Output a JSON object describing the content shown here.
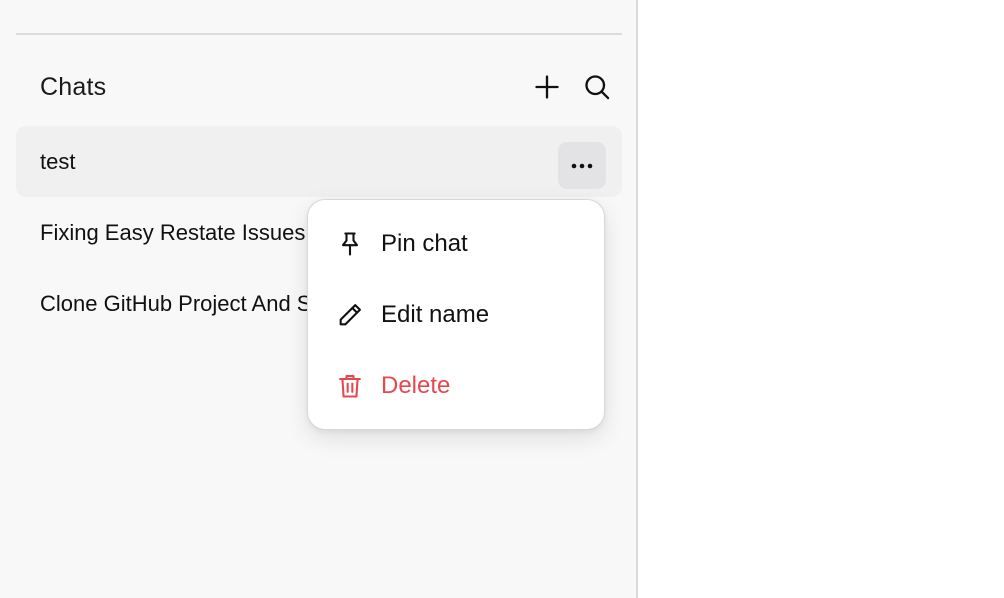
{
  "sidebar": {
    "section_title": "Chats",
    "new_chat_icon": "plus-icon",
    "search_icon": "search-icon",
    "chats": [
      {
        "label": "test",
        "active": true
      },
      {
        "label": "Fixing Easy Restate Issues",
        "active": false
      },
      {
        "label": "Clone GitHub Project And Setup",
        "active": false
      }
    ],
    "more_icon": "more-horizontal-icon"
  },
  "context_menu": {
    "items": [
      {
        "label": "Pin chat",
        "icon": "pin-icon"
      },
      {
        "label": "Edit name",
        "icon": "pencil-icon"
      },
      {
        "label": "Delete",
        "icon": "trash-icon",
        "color": "#e5484d"
      }
    ]
  },
  "colors": {
    "sidebar_bg": "#f8f8f8",
    "active_item_bg": "#f0f0f0",
    "danger": "#e5484d"
  }
}
